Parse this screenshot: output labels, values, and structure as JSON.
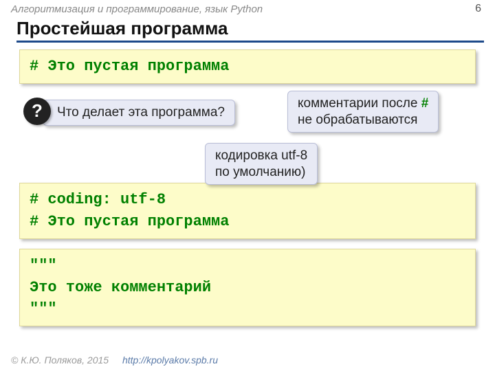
{
  "header": {
    "course": "Алгоритмизация и программирование, язык Python",
    "page": "6"
  },
  "title": "Простейшая программа",
  "code1": "# Это пустая программа",
  "question_badge": "?",
  "callouts": {
    "question": "Что делает эта программа?",
    "c1_pre": "комментарии после ",
    "c1_hash": "#",
    "c1_post": " не обрабатываются",
    "c2_line1": "кодировка utf-8",
    "c2_line2": "по умолчанию)"
  },
  "code2": {
    "line1": "# coding: utf-8",
    "line2": "# Это пустая программа"
  },
  "code3": {
    "line1": "\"\"\"",
    "line2": "Это тоже комментарий",
    "line3": "\"\"\""
  },
  "footer": {
    "copyright": "© К.Ю. Поляков, 2015",
    "url": "http://kpolyakov.spb.ru"
  }
}
